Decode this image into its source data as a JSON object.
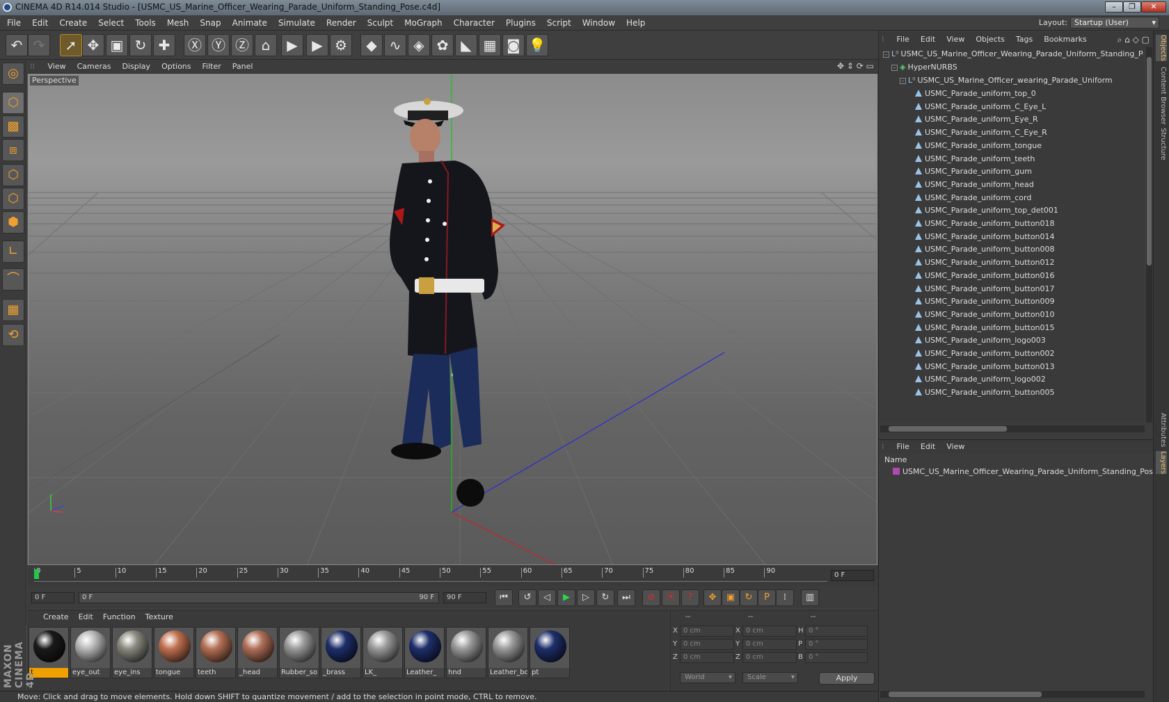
{
  "window": {
    "title": "CINEMA 4D R14.014 Studio - [USMC_US_Marine_Officer_Wearing_Parade_Uniform_Standing_Pose.c4d]",
    "min_btn": "–",
    "max_btn": "❐",
    "close_btn": "✕"
  },
  "menubar": {
    "items": [
      "File",
      "Edit",
      "Create",
      "Select",
      "Tools",
      "Mesh",
      "Snap",
      "Animate",
      "Simulate",
      "Render",
      "Sculpt",
      "MoGraph",
      "Character",
      "Plugins",
      "Script",
      "Window",
      "Help"
    ],
    "layout_label": "Layout:",
    "layout_value": "Startup (User)"
  },
  "toolbar": {
    "icons": [
      "undo-icon",
      "redo-icon",
      "live-selection-icon",
      "move-icon",
      "scale-icon",
      "rotate-icon",
      "add-icon",
      "x-axis-lock-icon",
      "y-axis-lock-icon",
      "z-axis-lock-icon",
      "coordinate-system-icon",
      "render-view-icon",
      "render-picture-viewer-icon",
      "render-settings-icon",
      "cube-icon",
      "spline-icon",
      "nurbs-icon",
      "array-icon",
      "deformer-icon",
      "floor-icon",
      "camera-icon",
      "light-icon"
    ],
    "glyphs": [
      "↶",
      "↷",
      "➚",
      "✥",
      "▣",
      "↻",
      "✚",
      "Ⓧ",
      "Ⓨ",
      "Ⓩ",
      "⌂",
      "▶",
      "▶",
      "⚙",
      "◆",
      "∿",
      "◈",
      "✿",
      "◣",
      "▦",
      "◙",
      "💡"
    ]
  },
  "lefttools": {
    "icons": [
      "make-editable-icon",
      "model-mode-icon",
      "texture-mode-icon",
      "workplane-icon",
      "points-mode-icon",
      "edges-mode-icon",
      "polygons-mode-icon",
      "axis-mode-icon",
      "magnet-icon",
      "snap-grid-icon",
      "quantize-icon"
    ],
    "glyphs": [
      "◎",
      "⬡",
      "▩",
      "⧈",
      "⬡",
      "⬡",
      "⬢",
      "∟",
      "⌒",
      "▦",
      "⟲"
    ]
  },
  "viewport": {
    "menu": [
      "View",
      "Cameras",
      "Display",
      "Options",
      "Filter",
      "Panel"
    ],
    "label": "Perspective"
  },
  "timeline": {
    "ticks": [
      "0",
      "5",
      "10",
      "15",
      "20",
      "25",
      "30",
      "35",
      "40",
      "45",
      "50",
      "55",
      "60",
      "65",
      "70",
      "75",
      "80",
      "85",
      "90"
    ],
    "current_frame": "0 F"
  },
  "animbar": {
    "start": "0 F",
    "range_left": "0 F",
    "range_right": "90 F",
    "end": "90 F",
    "buttons": [
      "go-to-start-icon",
      "previous-key-icon",
      "previous-frame-icon",
      "play-icon",
      "next-frame-icon",
      "next-key-icon",
      "go-to-end-icon",
      "record-icon",
      "autokey-icon",
      "keyframe-selection-icon",
      "move-key-icon",
      "scale-key-icon",
      "rotate-key-icon",
      "param-key-icon",
      "pla-key-icon",
      "timeline-icon"
    ],
    "glyphs": [
      "⏮",
      "↺",
      "◁",
      "▶",
      "▷",
      "↻",
      "⏭",
      "⊘",
      "⦿",
      "?",
      "✥",
      "▣",
      "↻",
      "P",
      "⁞",
      "▥"
    ]
  },
  "materials": {
    "menu": [
      "Create",
      "Edit",
      "Function",
      "Texture"
    ],
    "items": [
      {
        "label": "t",
        "color": "#1a1a1a",
        "selected": true
      },
      {
        "label": "eye_out",
        "color": "#b8b8b8",
        "selected": false
      },
      {
        "label": "eye_ins",
        "color": "#8a8a80",
        "selected": false
      },
      {
        "label": "tongue",
        "color": "#c07050",
        "selected": false
      },
      {
        "label": "teeth",
        "color": "#b57055",
        "selected": false
      },
      {
        "label": "_head",
        "color": "#b07058",
        "selected": false
      },
      {
        "label": "Rubber_so",
        "color": "#9a9a9a",
        "selected": false
      },
      {
        "label": "_brass",
        "color": "#1e2e6a",
        "selected": false
      },
      {
        "label": "LK_",
        "color": "#9a9a9a",
        "selected": false
      },
      {
        "label": "Leather_",
        "color": "#1e2e6a",
        "selected": false
      },
      {
        "label": "hnd",
        "color": "#9a9a9a",
        "selected": false
      },
      {
        "label": "Leather_bo",
        "color": "#9a9a9a",
        "selected": false
      },
      {
        "label": "pt",
        "color": "#1e2e6a",
        "selected": false
      }
    ]
  },
  "coords": {
    "headers": [
      "--",
      "--",
      "--"
    ],
    "rows": [
      {
        "a": "X",
        "av": "0 cm",
        "b": "X",
        "bv": "0 cm",
        "c": "H",
        "cv": "0 °"
      },
      {
        "a": "Y",
        "av": "0 cm",
        "b": "Y",
        "bv": "0 cm",
        "c": "P",
        "cv": "0 °"
      },
      {
        "a": "Z",
        "av": "0 cm",
        "b": "Z",
        "bv": "0 cm",
        "c": "B",
        "cv": "0 °"
      }
    ],
    "mode": "World",
    "scale": "Scale",
    "apply": "Apply"
  },
  "status": "Move: Click and drag to move elements. Hold down SHIFT to quantize movement / add to the selection in point mode, CTRL to remove.",
  "objects": {
    "menu": [
      "File",
      "Edit",
      "View",
      "Objects",
      "Tags",
      "Bookmarks"
    ],
    "root": "USMC_US_Marine_Officer_Wearing_Parade_Uniform_Standing_Pose",
    "hypernurbs": "HyperNURBS",
    "group": "USMC_US_Marine_Officer_wearing_Parade_Uniform",
    "children": [
      "USMC_Parade_uniform_top_0",
      "USMC_Parade_uniform_C_Eye_L",
      "USMC_Parade_uniform_Eye_R",
      "USMC_Parade_uniform_C_Eye_R",
      "USMC_Parade_uniform_tongue",
      "USMC_Parade_uniform_teeth",
      "USMC_Parade_uniform_gum",
      "USMC_Parade_uniform_head",
      "USMC_Parade_uniform_cord",
      "USMC_Parade_uniform_top_det001",
      "USMC_Parade_uniform_button018",
      "USMC_Parade_uniform_button014",
      "USMC_Parade_uniform_button008",
      "USMC_Parade_uniform_button012",
      "USMC_Parade_uniform_button016",
      "USMC_Parade_uniform_button017",
      "USMC_Parade_uniform_button009",
      "USMC_Parade_uniform_button010",
      "USMC_Parade_uniform_button015",
      "USMC_Parade_uniform_logo003",
      "USMC_Parade_uniform_button002",
      "USMC_Parade_uniform_button013",
      "USMC_Parade_uniform_logo002",
      "USMC_Parade_uniform_button005"
    ]
  },
  "layers": {
    "menu": [
      "File",
      "Edit",
      "View"
    ],
    "header": "Name",
    "row": "USMC_US_Marine_Officer_Wearing_Parade_Uniform_Standing_Pose"
  },
  "sidetabs": [
    "Objects",
    "Content Browser",
    "Structure",
    "Attributes",
    "Layers"
  ],
  "maxon": "MAXON CINEMA 4D"
}
